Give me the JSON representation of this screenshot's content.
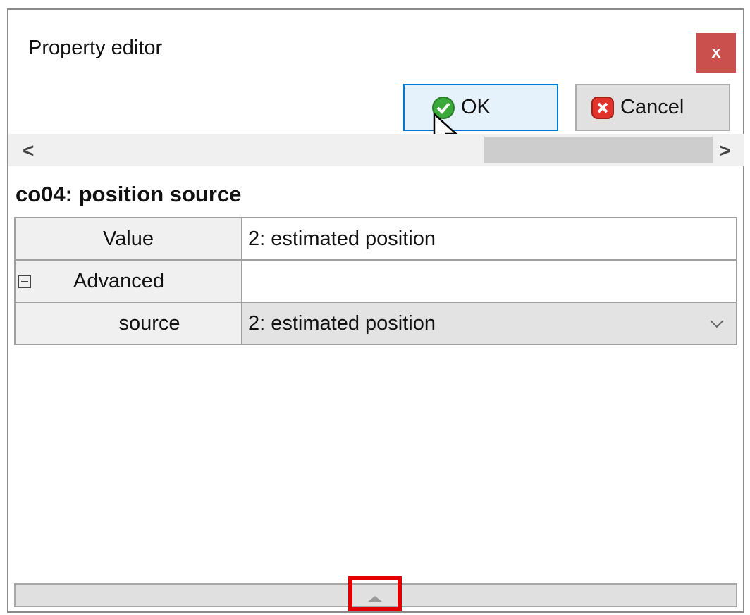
{
  "window": {
    "title": "Property editor",
    "close_label": "x"
  },
  "toolbar": {
    "ok_label": "OK",
    "cancel_label": "Cancel"
  },
  "hscroll": {
    "left_arrow": "<",
    "right_arrow": ">"
  },
  "property": {
    "title": "co04: position source",
    "rows": [
      {
        "name": "Value",
        "value": "2: estimated position"
      },
      {
        "name": "Advanced",
        "value": ""
      },
      {
        "name": "source",
        "value": "2: estimated position"
      }
    ]
  },
  "colors": {
    "close_bg": "#c9504d",
    "ok_border": "#0078d7",
    "highlight": "#e00000"
  }
}
